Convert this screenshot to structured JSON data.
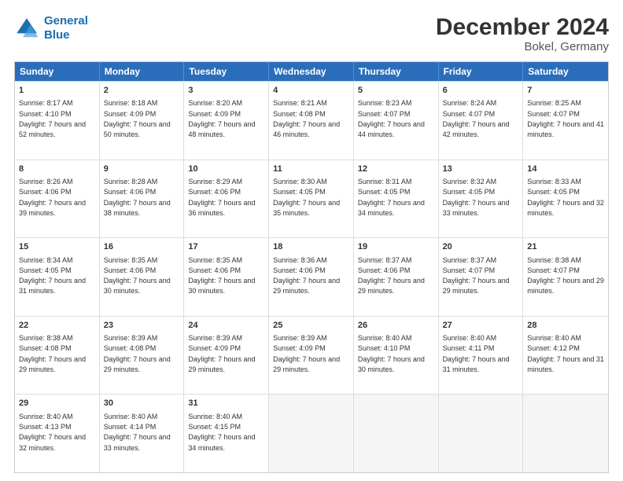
{
  "header": {
    "logo_line1": "General",
    "logo_line2": "Blue",
    "title": "December 2024",
    "subtitle": "Bokel, Germany"
  },
  "days_of_week": [
    "Sunday",
    "Monday",
    "Tuesday",
    "Wednesday",
    "Thursday",
    "Friday",
    "Saturday"
  ],
  "weeks": [
    [
      {
        "day": "1",
        "sunrise": "Sunrise: 8:17 AM",
        "sunset": "Sunset: 4:10 PM",
        "daylight": "Daylight: 7 hours and 52 minutes."
      },
      {
        "day": "2",
        "sunrise": "Sunrise: 8:18 AM",
        "sunset": "Sunset: 4:09 PM",
        "daylight": "Daylight: 7 hours and 50 minutes."
      },
      {
        "day": "3",
        "sunrise": "Sunrise: 8:20 AM",
        "sunset": "Sunset: 4:09 PM",
        "daylight": "Daylight: 7 hours and 48 minutes."
      },
      {
        "day": "4",
        "sunrise": "Sunrise: 8:21 AM",
        "sunset": "Sunset: 4:08 PM",
        "daylight": "Daylight: 7 hours and 46 minutes."
      },
      {
        "day": "5",
        "sunrise": "Sunrise: 8:23 AM",
        "sunset": "Sunset: 4:07 PM",
        "daylight": "Daylight: 7 hours and 44 minutes."
      },
      {
        "day": "6",
        "sunrise": "Sunrise: 8:24 AM",
        "sunset": "Sunset: 4:07 PM",
        "daylight": "Daylight: 7 hours and 42 minutes."
      },
      {
        "day": "7",
        "sunrise": "Sunrise: 8:25 AM",
        "sunset": "Sunset: 4:07 PM",
        "daylight": "Daylight: 7 hours and 41 minutes."
      }
    ],
    [
      {
        "day": "8",
        "sunrise": "Sunrise: 8:26 AM",
        "sunset": "Sunset: 4:06 PM",
        "daylight": "Daylight: 7 hours and 39 minutes."
      },
      {
        "day": "9",
        "sunrise": "Sunrise: 8:28 AM",
        "sunset": "Sunset: 4:06 PM",
        "daylight": "Daylight: 7 hours and 38 minutes."
      },
      {
        "day": "10",
        "sunrise": "Sunrise: 8:29 AM",
        "sunset": "Sunset: 4:06 PM",
        "daylight": "Daylight: 7 hours and 36 minutes."
      },
      {
        "day": "11",
        "sunrise": "Sunrise: 8:30 AM",
        "sunset": "Sunset: 4:05 PM",
        "daylight": "Daylight: 7 hours and 35 minutes."
      },
      {
        "day": "12",
        "sunrise": "Sunrise: 8:31 AM",
        "sunset": "Sunset: 4:05 PM",
        "daylight": "Daylight: 7 hours and 34 minutes."
      },
      {
        "day": "13",
        "sunrise": "Sunrise: 8:32 AM",
        "sunset": "Sunset: 4:05 PM",
        "daylight": "Daylight: 7 hours and 33 minutes."
      },
      {
        "day": "14",
        "sunrise": "Sunrise: 8:33 AM",
        "sunset": "Sunset: 4:05 PM",
        "daylight": "Daylight: 7 hours and 32 minutes."
      }
    ],
    [
      {
        "day": "15",
        "sunrise": "Sunrise: 8:34 AM",
        "sunset": "Sunset: 4:05 PM",
        "daylight": "Daylight: 7 hours and 31 minutes."
      },
      {
        "day": "16",
        "sunrise": "Sunrise: 8:35 AM",
        "sunset": "Sunset: 4:06 PM",
        "daylight": "Daylight: 7 hours and 30 minutes."
      },
      {
        "day": "17",
        "sunrise": "Sunrise: 8:35 AM",
        "sunset": "Sunset: 4:06 PM",
        "daylight": "Daylight: 7 hours and 30 minutes."
      },
      {
        "day": "18",
        "sunrise": "Sunrise: 8:36 AM",
        "sunset": "Sunset: 4:06 PM",
        "daylight": "Daylight: 7 hours and 29 minutes."
      },
      {
        "day": "19",
        "sunrise": "Sunrise: 8:37 AM",
        "sunset": "Sunset: 4:06 PM",
        "daylight": "Daylight: 7 hours and 29 minutes."
      },
      {
        "day": "20",
        "sunrise": "Sunrise: 8:37 AM",
        "sunset": "Sunset: 4:07 PM",
        "daylight": "Daylight: 7 hours and 29 minutes."
      },
      {
        "day": "21",
        "sunrise": "Sunrise: 8:38 AM",
        "sunset": "Sunset: 4:07 PM",
        "daylight": "Daylight: 7 hours and 29 minutes."
      }
    ],
    [
      {
        "day": "22",
        "sunrise": "Sunrise: 8:38 AM",
        "sunset": "Sunset: 4:08 PM",
        "daylight": "Daylight: 7 hours and 29 minutes."
      },
      {
        "day": "23",
        "sunrise": "Sunrise: 8:39 AM",
        "sunset": "Sunset: 4:08 PM",
        "daylight": "Daylight: 7 hours and 29 minutes."
      },
      {
        "day": "24",
        "sunrise": "Sunrise: 8:39 AM",
        "sunset": "Sunset: 4:09 PM",
        "daylight": "Daylight: 7 hours and 29 minutes."
      },
      {
        "day": "25",
        "sunrise": "Sunrise: 8:39 AM",
        "sunset": "Sunset: 4:09 PM",
        "daylight": "Daylight: 7 hours and 29 minutes."
      },
      {
        "day": "26",
        "sunrise": "Sunrise: 8:40 AM",
        "sunset": "Sunset: 4:10 PM",
        "daylight": "Daylight: 7 hours and 30 minutes."
      },
      {
        "day": "27",
        "sunrise": "Sunrise: 8:40 AM",
        "sunset": "Sunset: 4:11 PM",
        "daylight": "Daylight: 7 hours and 31 minutes."
      },
      {
        "day": "28",
        "sunrise": "Sunrise: 8:40 AM",
        "sunset": "Sunset: 4:12 PM",
        "daylight": "Daylight: 7 hours and 31 minutes."
      }
    ],
    [
      {
        "day": "29",
        "sunrise": "Sunrise: 8:40 AM",
        "sunset": "Sunset: 4:13 PM",
        "daylight": "Daylight: 7 hours and 32 minutes."
      },
      {
        "day": "30",
        "sunrise": "Sunrise: 8:40 AM",
        "sunset": "Sunset: 4:14 PM",
        "daylight": "Daylight: 7 hours and 33 minutes."
      },
      {
        "day": "31",
        "sunrise": "Sunrise: 8:40 AM",
        "sunset": "Sunset: 4:15 PM",
        "daylight": "Daylight: 7 hours and 34 minutes."
      },
      null,
      null,
      null,
      null
    ]
  ]
}
